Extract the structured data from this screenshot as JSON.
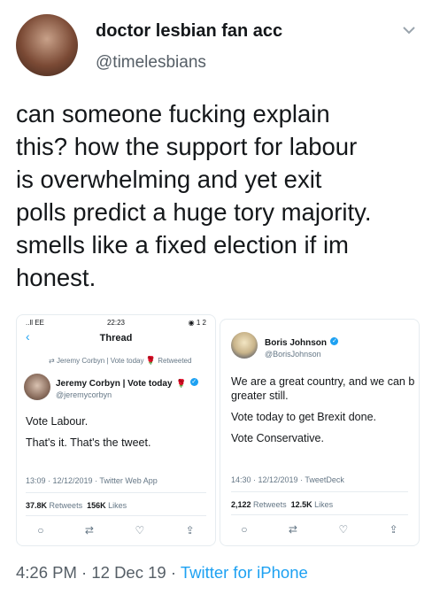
{
  "header": {
    "display_name": "doctor lesbian fan acc",
    "handle": "@timelesbians",
    "menu_icon": "chevron-down-icon"
  },
  "tweet": {
    "lines": [
      "can someone fucking explain",
      "this? how the support for labour",
      "is overwhelming and yet exit",
      "polls predict a huge tory majority.",
      "smells like a fixed election if im",
      "honest."
    ]
  },
  "card1": {
    "status_carrier": "..ll EE",
    "status_time": "22:23",
    "status_right": "◉ 1 2",
    "title": "Thread",
    "retweeted_line": "Jeremy Corbyn | Vote today",
    "retweeted_suffix": "Retweeted",
    "author_name": "Jeremy Corbyn | Vote today",
    "author_handle": "@jeremycorbyn",
    "body": [
      "Vote Labour.",
      "That's it. That's the tweet."
    ],
    "timestamp": "13:09 · 12/12/2019 · Twitter Web App",
    "retweets_count": "37.8K",
    "retweets_label": "Retweets",
    "likes_count": "156K",
    "likes_label": "Likes"
  },
  "card2": {
    "author_name": "Boris Johnson",
    "author_handle": "@BorisJohnson",
    "body": [
      "We are a great country, and we can b",
      "greater still.",
      "Vote today to get Brexit done.",
      "Vote Conservative."
    ],
    "timestamp": "14:30 · 12/12/2019 · TweetDeck",
    "retweets_count": "2,122",
    "retweets_label": "Retweets",
    "likes_count": "12.5K",
    "likes_label": "Likes"
  },
  "footer": {
    "time": "4:26 PM",
    "date": "12 Dec 19",
    "source": "Twitter for iPhone"
  },
  "colors": {
    "accent": "#1da1f2",
    "muted": "#657786"
  }
}
